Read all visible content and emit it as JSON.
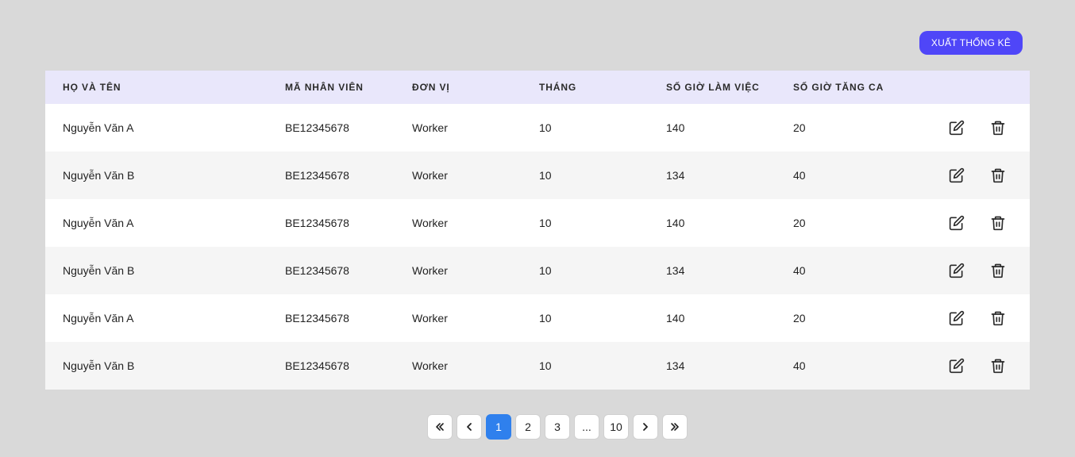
{
  "toolbar": {
    "export_label": "XUẤT THỐNG KÊ"
  },
  "table": {
    "headers": [
      "HỌ VÀ TÊN",
      "MÃ NHÂN VIÊN",
      "ĐƠN VỊ",
      "THÁNG",
      "SỐ GIỜ LÀM VIỆC",
      "SỐ GIỜ TĂNG CA"
    ],
    "rows": [
      [
        "Nguyễn Văn A",
        "BE12345678",
        "Worker",
        "10",
        "140",
        "20"
      ],
      [
        "Nguyễn Văn B",
        "BE12345678",
        "Worker",
        "10",
        "134",
        "40"
      ],
      [
        "Nguyễn Văn A",
        "BE12345678",
        "Worker",
        "10",
        "140",
        "20"
      ],
      [
        "Nguyễn Văn B",
        "BE12345678",
        "Worker",
        "10",
        "134",
        "40"
      ],
      [
        "Nguyễn Văn A",
        "BE12345678",
        "Worker",
        "10",
        "140",
        "20"
      ],
      [
        "Nguyễn Văn B",
        "BE12345678",
        "Worker",
        "10",
        "134",
        "40"
      ]
    ],
    "row_actions": [
      "edit-icon",
      "trash-icon"
    ]
  },
  "pagination": {
    "first_icon": "double-chevron-left-icon",
    "prev_icon": "chevron-left-icon",
    "pages": [
      "1",
      "2",
      "3",
      "...",
      "10"
    ],
    "active_page": "1",
    "next_icon": "chevron-right-icon",
    "last_icon": "double-chevron-right-icon"
  },
  "colors": {
    "background": "#d9d9d9",
    "accent": "#4f46f8",
    "header_bg": "#e9e7fb",
    "active_page": "#2f80ed"
  }
}
